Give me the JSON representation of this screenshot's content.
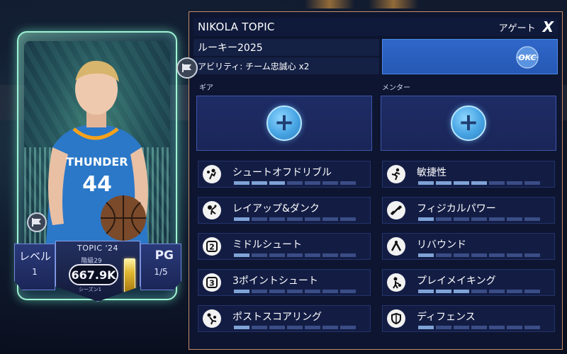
{
  "player": {
    "name": "NIKOLA TOPIC",
    "card_name": "TOPIC '24",
    "tier": "階級29",
    "overall": "667.9K",
    "season_label": "シーズン1",
    "position": "PG",
    "level_label": "レベル",
    "level_value": "1",
    "position_value": "1/5",
    "jersey_number": "44",
    "jersey_team": "THUNDER"
  },
  "panel": {
    "agate_label": "アゲート",
    "close_label": "X",
    "rookie_line": "ルーキー2025",
    "ability_line": "アビリティ: チーム忠誠心 x2",
    "team_logo_text": "OKC",
    "gear_label": "ギア",
    "mentor_label": "メンター",
    "plus_glyph": "+"
  },
  "attributes_left": [
    {
      "name": "シュートオフドリブル",
      "icon": "basketball-shot-icon",
      "filled": 0.4
    },
    {
      "name": "レイアップ&ダンク",
      "icon": "dunk-icon",
      "filled": 0.2
    },
    {
      "name": "ミドルシュート",
      "icon": "number-2-icon",
      "filled": 0.2
    },
    {
      "name": "3ポイントシュート",
      "icon": "number-3-icon",
      "filled": 0.2
    },
    {
      "name": "ポストスコアリング",
      "icon": "post-scoring-icon",
      "filled": 0.2
    }
  ],
  "attributes_right": [
    {
      "name": "敏捷性",
      "icon": "running-icon",
      "filled": 0.6
    },
    {
      "name": "フィジカルパワー",
      "icon": "dumbbell-icon",
      "filled": 0.2
    },
    {
      "name": "リバウンド",
      "icon": "rebound-icon",
      "filled": 0.2
    },
    {
      "name": "プレイメイキング",
      "icon": "playmaking-icon",
      "filled": 0.4
    },
    {
      "name": "ディフェンス",
      "icon": "shield-icon",
      "filled": 0.2
    }
  ],
  "colors": {
    "panel_border": "#c98e67",
    "team_blue": "#2f67c9",
    "bar_on": "#7fa3d6",
    "bar_off": "#3b4d86"
  }
}
